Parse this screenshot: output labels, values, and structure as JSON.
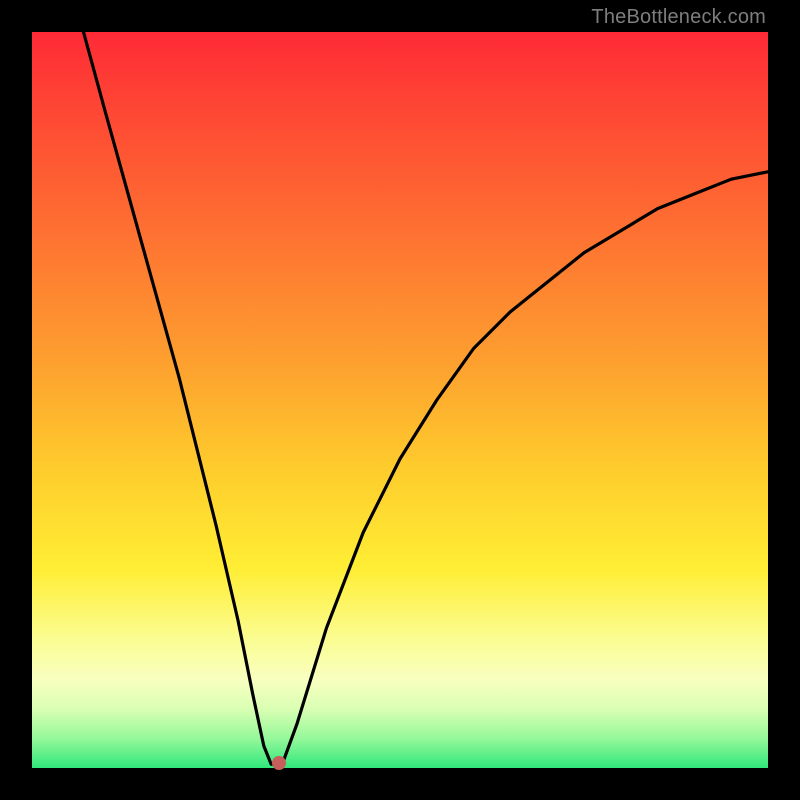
{
  "watermark": "TheBottleneck.com",
  "chart_data": {
    "type": "line",
    "title": "",
    "xlabel": "",
    "ylabel": "",
    "xlim": [
      0,
      100
    ],
    "ylim": [
      0,
      100
    ],
    "grid": false,
    "legend": false,
    "series": [
      {
        "name": "curve",
        "x": [
          7,
          10,
          15,
          20,
          25,
          28,
          30,
          31.5,
          32.5,
          34,
          36,
          40,
          45,
          50,
          55,
          60,
          65,
          70,
          75,
          80,
          85,
          90,
          95,
          100
        ],
        "y": [
          100,
          89,
          71,
          53,
          33,
          20,
          10,
          3,
          0.5,
          0.5,
          6,
          19,
          32,
          42,
          50,
          57,
          62,
          66,
          70,
          73,
          76,
          78,
          80,
          81
        ]
      }
    ],
    "annotations": [
      {
        "name": "marker",
        "x": 33.5,
        "y": 0.7,
        "color": "#c65e5b"
      }
    ],
    "background_gradient": {
      "direction": "vertical",
      "stops": [
        {
          "pos": 0,
          "color": "#fe2a36"
        },
        {
          "pos": 45,
          "color": "#fda02f"
        },
        {
          "pos": 73,
          "color": "#ffee35"
        },
        {
          "pos": 100,
          "color": "#2fe77b"
        }
      ]
    }
  }
}
